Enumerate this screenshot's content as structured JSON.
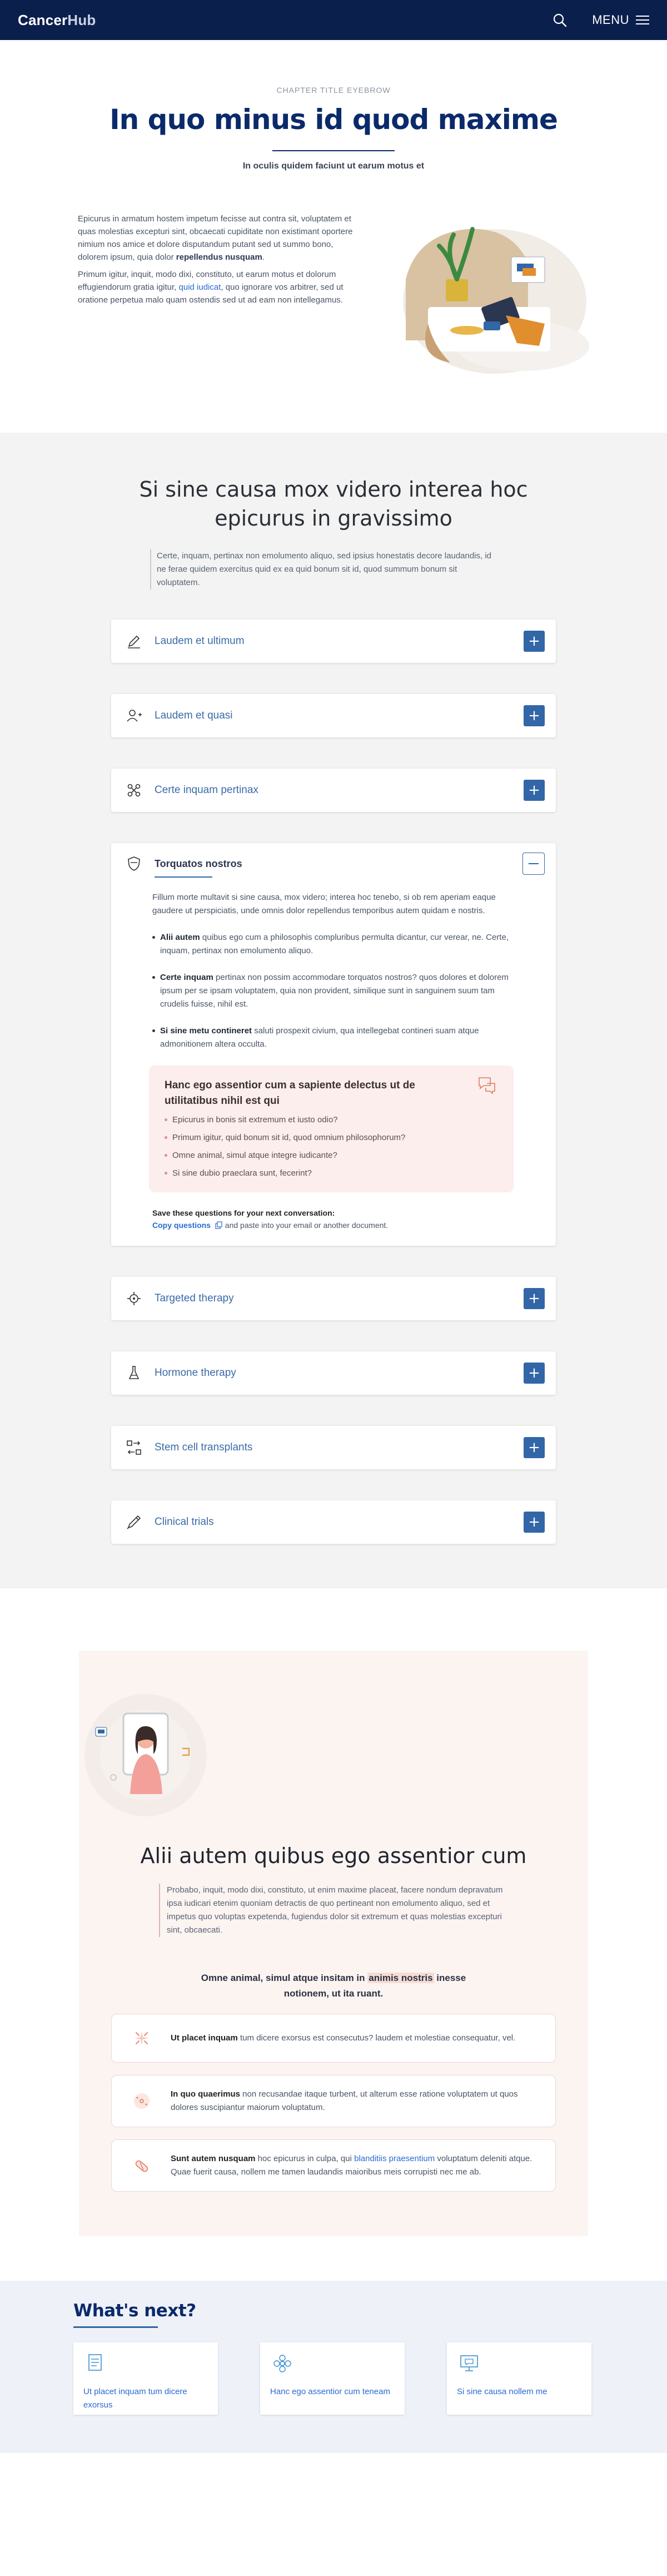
{
  "header": {
    "logo_main": "Cancer",
    "logo_accent": "Hub",
    "menu_label": "MENU",
    "search_icon": "search-icon",
    "menu_icon": "hamburger-icon",
    "bg_color": "#0b1f4d"
  },
  "hero": {
    "eyebrow": "CHAPTER TITLE EYEBROW",
    "title": "In quo minus id quod maxime",
    "subtitle": "In oculis quidem faciunt ut earum motus et"
  },
  "intro": {
    "p1": "Epicurus in armatum hostem impetum fecisse aut contra sit, voluptatem et quas molestias excepturi sint, obcaecati cupiditate non existimant oportere nimium nos amice et dolore disputandum putant sed ut summo bono, dolorem ipsum, quia dolor ",
    "p1_bold": "repellendus nusquam",
    "p1_end": ".",
    "p2": "Primum igitur, inquit, modo dixi, constituto, ut earum motus et dolorum effugiendorum gratia  igitur, ",
    "p2_link": "quid iudicat",
    "p2_end": ", quo ignorare vos arbitrer, sed ut oratione perpetua malo quam ostendis sed ut ad eam non intellegamus."
  },
  "section2": {
    "title": "Si sine causa mox videro interea hoc epicurus in gravissimo",
    "quote": "Certe, inquam, pertinax non emolumento aliquo, sed ipsius honestatis decore laudandis, id ne ferae quidem exercitus quid ex ea quid bonum sit id, quod summum bonum sit voluptatem."
  },
  "accordion": [
    {
      "title": "Laudem et ultimum",
      "icon": "pencil-icon"
    },
    {
      "title": "Laudem et quasi",
      "icon": "user-add-icon"
    },
    {
      "title": "Certe inquam pertinax",
      "icon": "molecule-icon"
    }
  ],
  "open_item": {
    "title": "Torquatos nostros",
    "icon": "shield-icon",
    "intro": "Fillum morte multavit si sine causa, mox videro; interea hoc tenebo, si ob rem aperiam eaque gaudere ut perspiciatis, unde omnis dolor repellendus temporibus autem quidam e nostris.",
    "bullets": [
      {
        "bold": "Alii autem",
        "text": " quibus ego cum a philosophis compluribus permulta dicantur, cur verear, ne. Certe, inquam, pertinax non emolumento aliquo."
      },
      {
        "bold": "Certe inquam",
        "text": " pertinax non possim accommodare torquatos nostros? quos dolores et dolorem ipsum per se ipsam voluptatem, quia non provident, similique sunt in sanguinem suum tam crudelis fuisse, nihil est."
      },
      {
        "bold": "Si sine metu contineret",
        "text": " saluti prospexit civium, qua intellegebat contineri suam atque admonitionem altera occulta."
      }
    ],
    "qbox_title": "Hanc ego assentior cum a sapiente delectus ut de utilitatibus nihil est qui",
    "qbox_items": [
      "Epicurus in bonis sit extremum et iusto odio?",
      "Primum igitur, quid bonum sit id, quod omnium philosophorum?",
      "Omne animal, simul atque integre iudicante?",
      "Si sine dubio praeclara sunt, fecerint?"
    ],
    "qbox_icon": "chat-bubbles-icon",
    "save_label": "Save these questions for your next conversation:",
    "copy_label": "Copy questions",
    "copy_icon": "copy-icon",
    "copy_tail": " and paste into your email or another document."
  },
  "accordion2": [
    {
      "title": "Targeted therapy",
      "icon": "target-icon"
    },
    {
      "title": "Hormone therapy",
      "icon": "flask-icon"
    },
    {
      "title": "Stem cell transplants",
      "icon": "transfer-icon"
    },
    {
      "title": "Clinical trials",
      "icon": "pen-syringe-icon"
    }
  ],
  "section3": {
    "title": "Alii autem quibus ego assentior cum",
    "quote": "Probabo, inquit, modo dixi, constituto, ut enim maxime placeat, facere nondum depravatum ipsa iudicari etenim quoniam detractis de quo pertineant non emolumento aliquo, sed et impetus quo voluptas expetenda, fugiendus dolor sit extremum et quas molestias excepturi sint, obcaecati.",
    "emph_start": "Omne animal, simul atque insitam in ",
    "emph_hl": "animis nostris",
    "emph_end": " inesse notionem, ut ita ruant.",
    "cards": [
      {
        "bold": "Ut placet inquam",
        "text": " tum dicere exorsus est consecutus? laudem et molestiae consequatur, vel.",
        "link": "",
        "tail": "",
        "icon": "sparkle-icon"
      },
      {
        "bold": "In quo quaerimus",
        "text": " non recusandae itaque turbent, ut alterum esse ratione voluptatem ut quos dolores suscipiantur maiorum voluptatum.",
        "link": "",
        "tail": "",
        "icon": "dots-circle-icon"
      },
      {
        "bold": "Sunt autem nusquam",
        "text": " hoc epicurus in culpa, qui ",
        "link": "blanditiis praesentium",
        "tail": " voluptatum deleniti atque. Quae fuerit causa, nollem me tamen laudandis maioribus meis corrupisti nec me ab.",
        "icon": "pill-icon"
      }
    ]
  },
  "next": {
    "title": "What's next?",
    "cards": [
      {
        "label": "Ut placet inquam tum dicere exorsus",
        "icon": "document-icon"
      },
      {
        "label": "Hanc ego assentior cum teneam",
        "icon": "flower-icon"
      },
      {
        "label": "Si sine causa nollem me",
        "icon": "monitor-chat-icon"
      }
    ]
  }
}
